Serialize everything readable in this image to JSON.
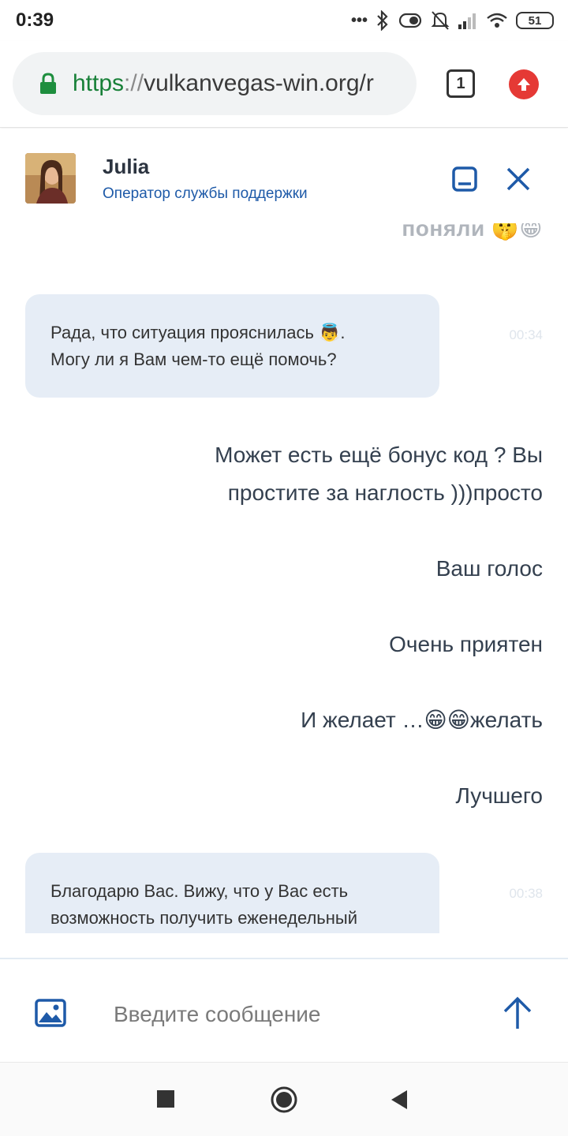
{
  "status_bar": {
    "time": "0:39",
    "dots": "•••",
    "battery": "51"
  },
  "browser": {
    "url_scheme": "https",
    "url_sep": "://",
    "url_host": "vulkanvegas-win.org/r",
    "tab_count": "1",
    "colors": {
      "lock": "#1e8e3e",
      "upgrade": "#e53935"
    }
  },
  "chat_header": {
    "operator_name": "Julia",
    "operator_role": "Оператор службы поддержки",
    "accent": "#1e5aa8"
  },
  "chat": {
    "clipped_message": "поняли 🤫😁",
    "messages": [
      {
        "from": "operator",
        "text_line1": "Рада, что ситуация прояснилась 👼.",
        "text_line2": "Могу ли я Вам чем-то ещё помочь?",
        "time": "00:34"
      },
      {
        "from": "user",
        "text_line1": "Может есть ещё бонус код ? Вы",
        "text_line2": "простите за наглость )))просто"
      },
      {
        "from": "user",
        "text": "Ваш голос"
      },
      {
        "from": "user",
        "text": "Очень приятен"
      },
      {
        "from": "user",
        "text": "И желает …😁😁желать"
      },
      {
        "from": "user",
        "text": "Лучшего"
      },
      {
        "from": "operator",
        "text_line1": "Благодарю Вас. Вижу, что у Вас есть",
        "text_line2": "возможность получить еженедельный",
        "time": "00:38"
      }
    ]
  },
  "input": {
    "placeholder": "Введите сообщение",
    "accent": "#1e5aa8"
  }
}
